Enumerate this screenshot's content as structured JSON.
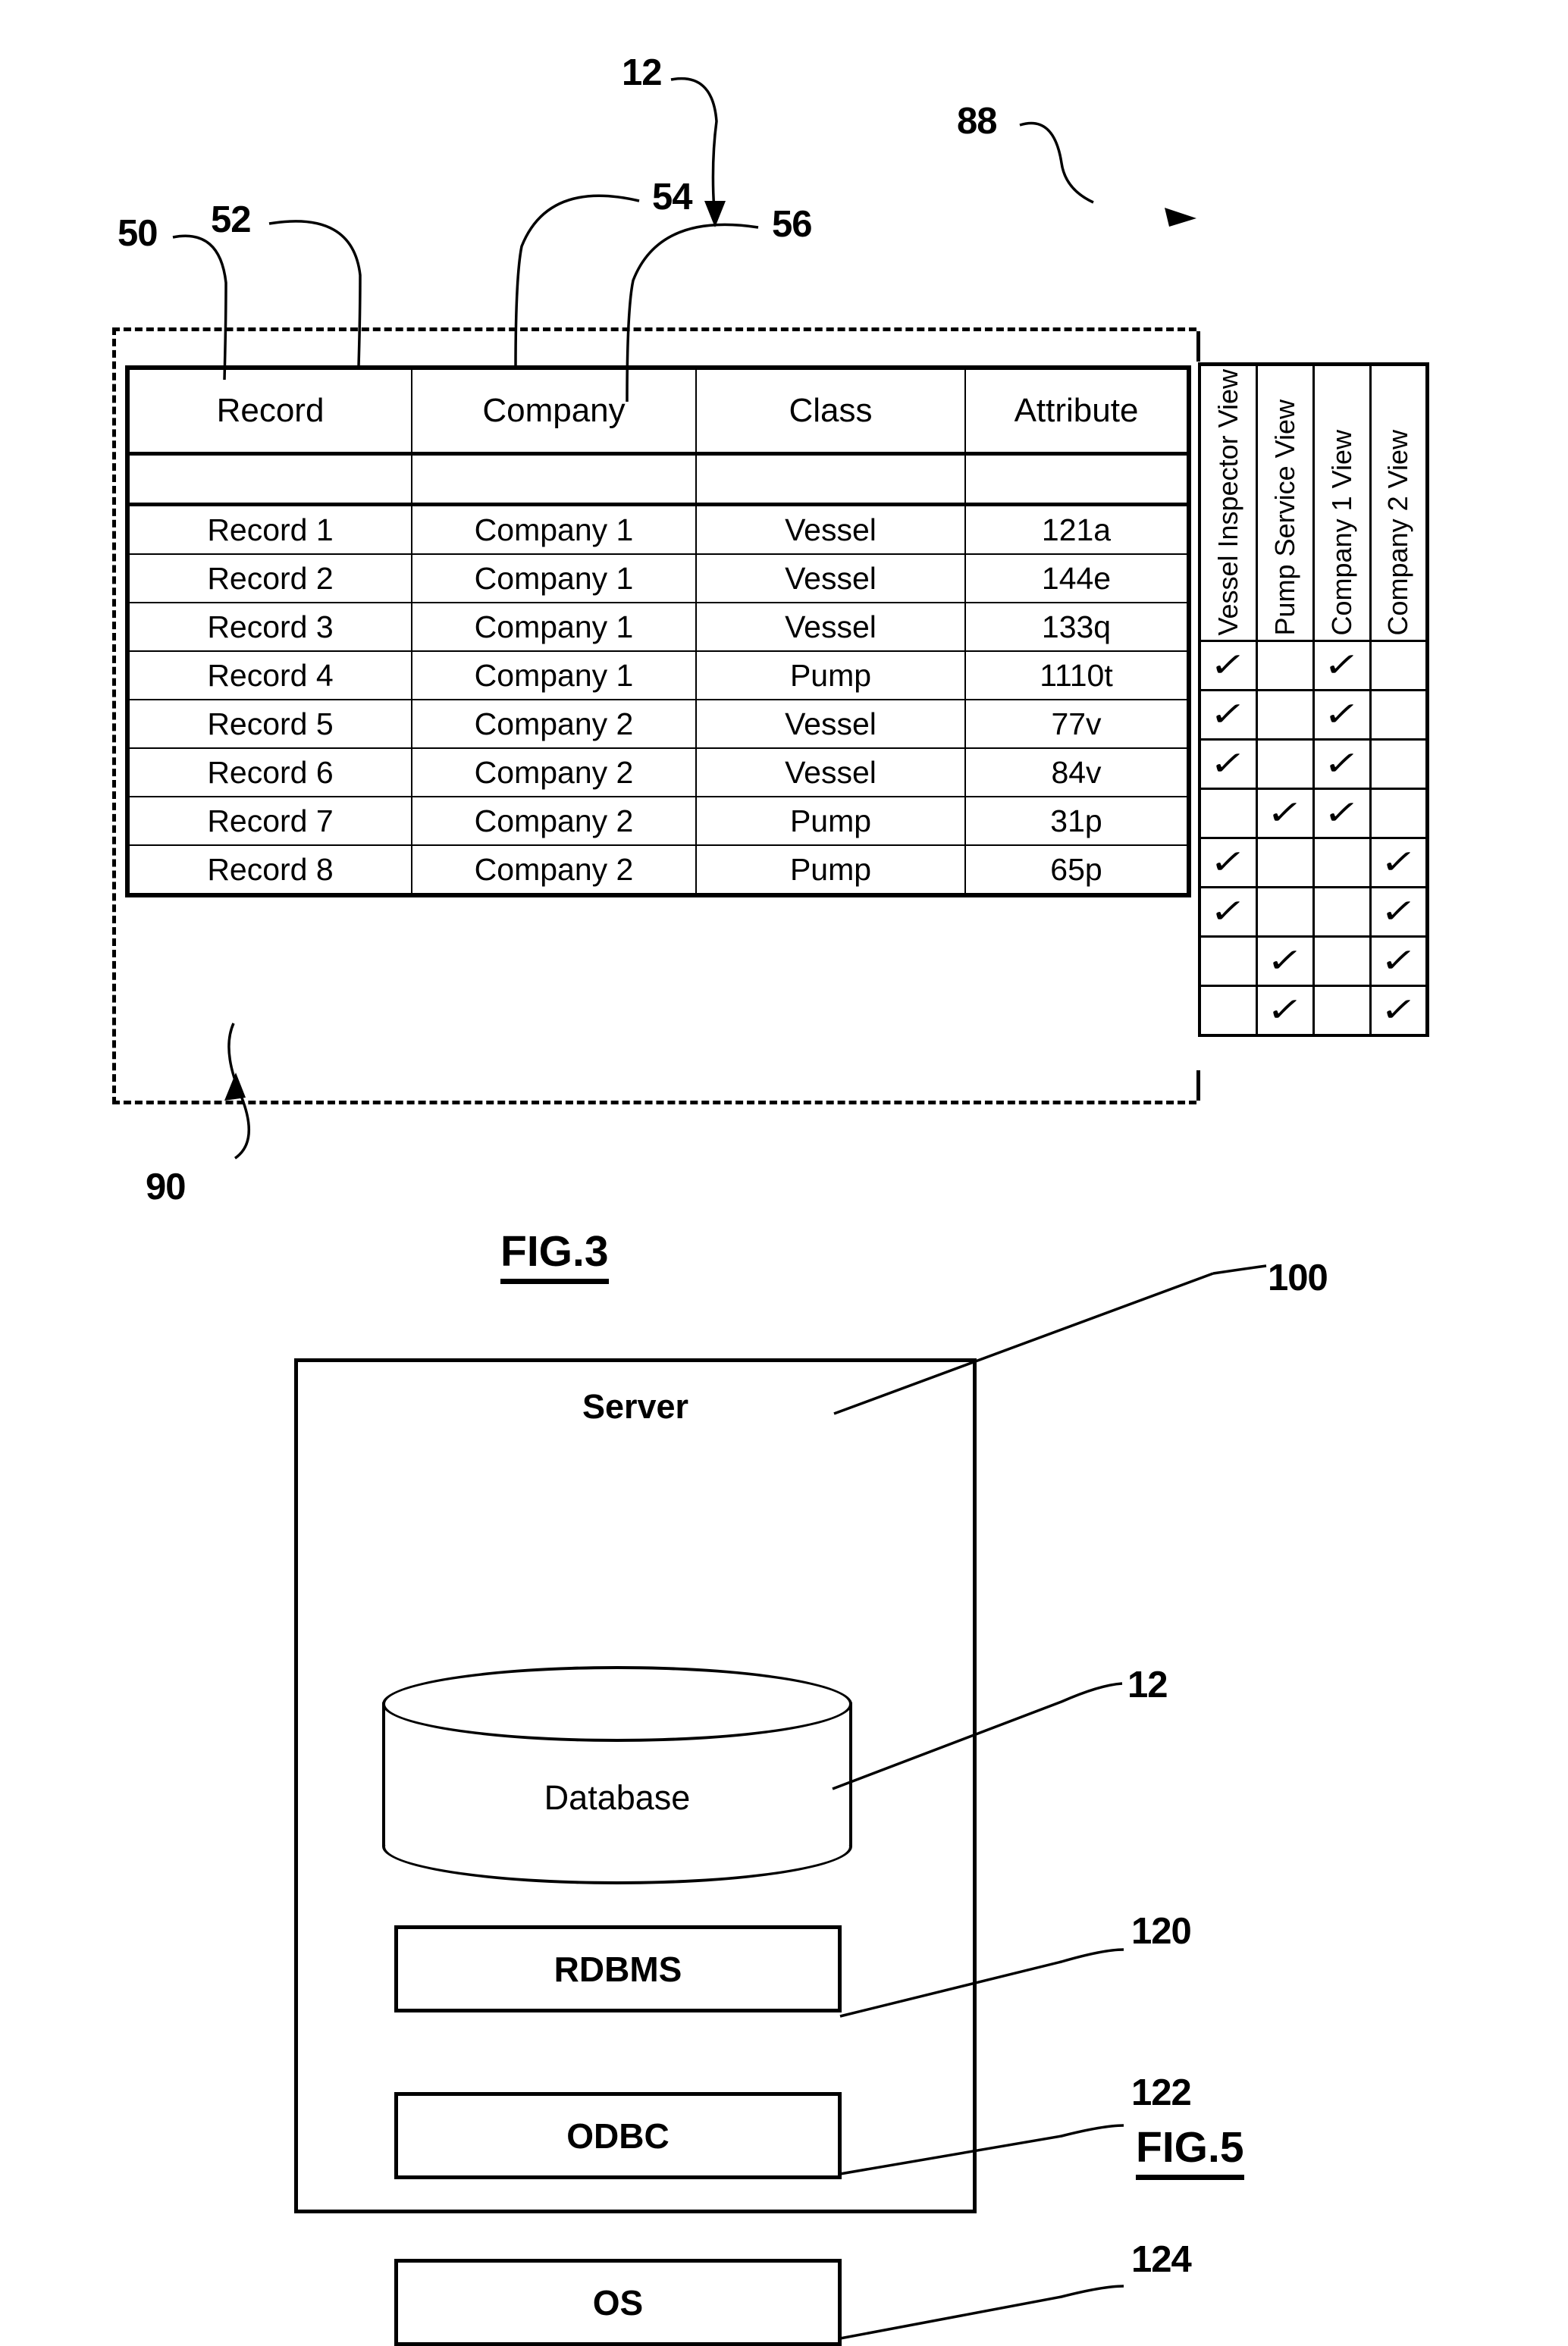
{
  "figure3": {
    "label": "FIG.3",
    "reference_numerals": {
      "database": "12",
      "record_column": "50",
      "company_column": "52",
      "class_column": "54",
      "attribute_column": "56",
      "views_block": "88",
      "table_boundary": "90"
    },
    "table": {
      "headers": [
        "Record",
        "Company",
        "Class",
        "Attribute"
      ],
      "spacer_row": [
        "",
        "",
        "",
        ""
      ],
      "rows": [
        [
          "Record 1",
          "Company 1",
          "Vessel",
          "121a"
        ],
        [
          "Record 2",
          "Company 1",
          "Vessel",
          "144e"
        ],
        [
          "Record 3",
          "Company 1",
          "Vessel",
          "133q"
        ],
        [
          "Record 4",
          "Company 1",
          "Pump",
          "1110t"
        ],
        [
          "Record 5",
          "Company 2",
          "Vessel",
          "77v"
        ],
        [
          "Record 6",
          "Company 2",
          "Vessel",
          "84v"
        ],
        [
          "Record 7",
          "Company 2",
          "Pump",
          "31p"
        ],
        [
          "Record 8",
          "Company 2",
          "Pump",
          "65p"
        ]
      ]
    },
    "views": {
      "headers": [
        "Vessel Inspector View",
        "Pump Service View",
        "Company 1 View",
        "Company 2 View"
      ],
      "checkmark_glyph": "✓",
      "matrix": [
        [
          true,
          false,
          true,
          false
        ],
        [
          true,
          false,
          true,
          false
        ],
        [
          true,
          false,
          true,
          false
        ],
        [
          false,
          true,
          true,
          false
        ],
        [
          true,
          false,
          false,
          true
        ],
        [
          true,
          false,
          false,
          true
        ],
        [
          false,
          true,
          false,
          true
        ],
        [
          false,
          true,
          false,
          true
        ]
      ]
    }
  },
  "figure5": {
    "label": "FIG.5",
    "server_title": "Server",
    "database_label": "Database",
    "stack": [
      {
        "label": "RDBMS",
        "ref": "120"
      },
      {
        "label": "ODBC",
        "ref": "122"
      },
      {
        "label": "OS",
        "ref": "124"
      }
    ],
    "reference_numerals": {
      "server": "100",
      "database": "12"
    }
  }
}
